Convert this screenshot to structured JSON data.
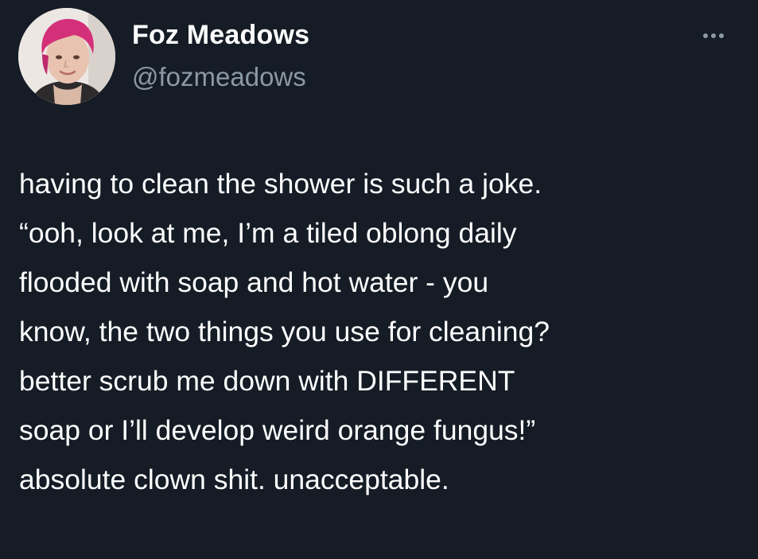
{
  "author": {
    "display_name": "Foz Meadows",
    "handle": "@fozmeadows",
    "avatar_icon": "profile-photo"
  },
  "menu": {
    "icon": "more-horizontal-icon"
  },
  "tweet": {
    "lines": [
      "having to clean the shower is such a joke.",
      "“ooh, look at me, I’m a tiled oblong daily",
      "flooded with soap and hot water - you",
      "know, the two things you use for cleaning?",
      "better scrub me down with DIFFERENT",
      "soap or I’ll develop weird orange fungus!”",
      "absolute clown shit. unacceptable."
    ]
  },
  "colors": {
    "background": "#151c26",
    "primary_text": "#ffffff",
    "secondary_text": "#8b98a5",
    "avatar_hair": "#d4307a"
  }
}
